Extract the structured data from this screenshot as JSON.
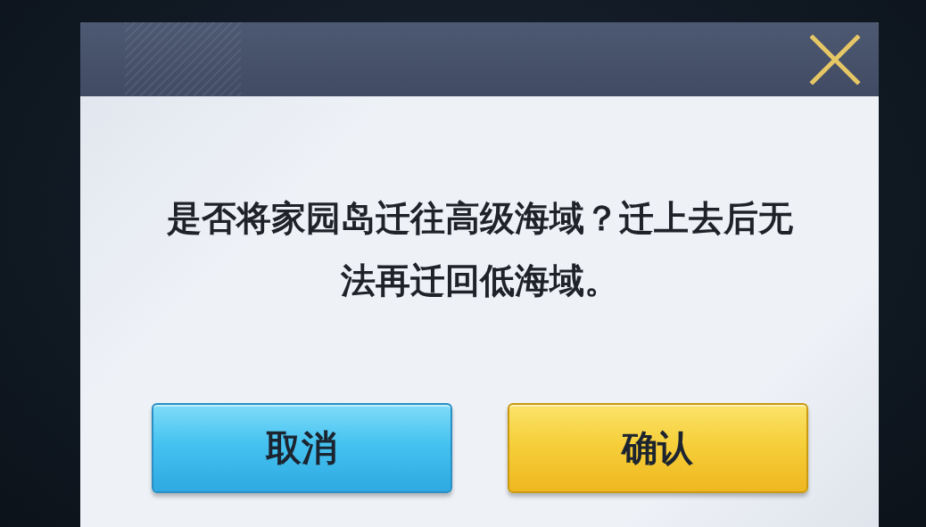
{
  "dialog": {
    "message": "是否将家园岛迁往高级海域？迁上去后无法再迁回低海域。",
    "buttons": [
      {
        "label": "取消",
        "kind": "cancel"
      },
      {
        "label": "确认",
        "kind": "confirm"
      }
    ]
  }
}
